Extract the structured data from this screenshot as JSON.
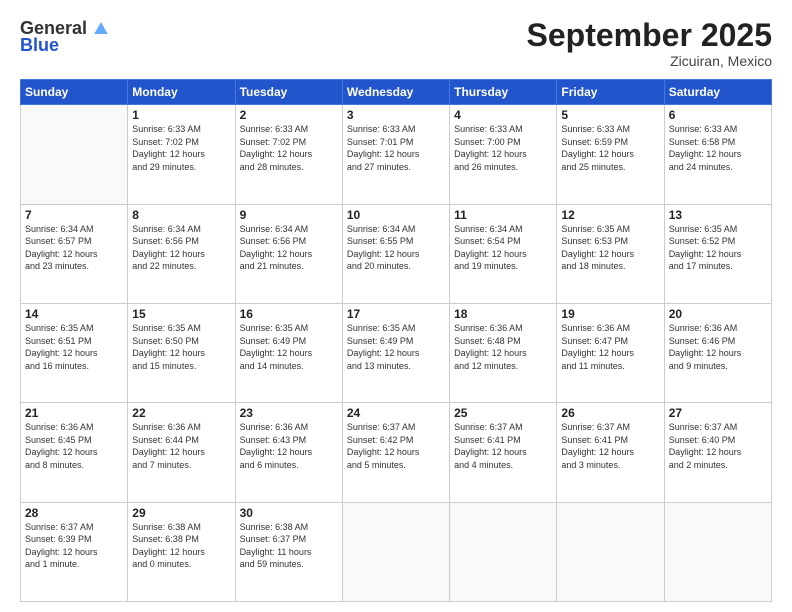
{
  "logo": {
    "general": "General",
    "blue": "Blue"
  },
  "header": {
    "month": "September 2025",
    "location": "Zicuiran, Mexico"
  },
  "days_of_week": [
    "Sunday",
    "Monday",
    "Tuesday",
    "Wednesday",
    "Thursday",
    "Friday",
    "Saturday"
  ],
  "weeks": [
    [
      {
        "num": "",
        "info": ""
      },
      {
        "num": "1",
        "info": "Sunrise: 6:33 AM\nSunset: 7:02 PM\nDaylight: 12 hours\nand 29 minutes."
      },
      {
        "num": "2",
        "info": "Sunrise: 6:33 AM\nSunset: 7:02 PM\nDaylight: 12 hours\nand 28 minutes."
      },
      {
        "num": "3",
        "info": "Sunrise: 6:33 AM\nSunset: 7:01 PM\nDaylight: 12 hours\nand 27 minutes."
      },
      {
        "num": "4",
        "info": "Sunrise: 6:33 AM\nSunset: 7:00 PM\nDaylight: 12 hours\nand 26 minutes."
      },
      {
        "num": "5",
        "info": "Sunrise: 6:33 AM\nSunset: 6:59 PM\nDaylight: 12 hours\nand 25 minutes."
      },
      {
        "num": "6",
        "info": "Sunrise: 6:33 AM\nSunset: 6:58 PM\nDaylight: 12 hours\nand 24 minutes."
      }
    ],
    [
      {
        "num": "7",
        "info": "Sunrise: 6:34 AM\nSunset: 6:57 PM\nDaylight: 12 hours\nand 23 minutes."
      },
      {
        "num": "8",
        "info": "Sunrise: 6:34 AM\nSunset: 6:56 PM\nDaylight: 12 hours\nand 22 minutes."
      },
      {
        "num": "9",
        "info": "Sunrise: 6:34 AM\nSunset: 6:56 PM\nDaylight: 12 hours\nand 21 minutes."
      },
      {
        "num": "10",
        "info": "Sunrise: 6:34 AM\nSunset: 6:55 PM\nDaylight: 12 hours\nand 20 minutes."
      },
      {
        "num": "11",
        "info": "Sunrise: 6:34 AM\nSunset: 6:54 PM\nDaylight: 12 hours\nand 19 minutes."
      },
      {
        "num": "12",
        "info": "Sunrise: 6:35 AM\nSunset: 6:53 PM\nDaylight: 12 hours\nand 18 minutes."
      },
      {
        "num": "13",
        "info": "Sunrise: 6:35 AM\nSunset: 6:52 PM\nDaylight: 12 hours\nand 17 minutes."
      }
    ],
    [
      {
        "num": "14",
        "info": "Sunrise: 6:35 AM\nSunset: 6:51 PM\nDaylight: 12 hours\nand 16 minutes."
      },
      {
        "num": "15",
        "info": "Sunrise: 6:35 AM\nSunset: 6:50 PM\nDaylight: 12 hours\nand 15 minutes."
      },
      {
        "num": "16",
        "info": "Sunrise: 6:35 AM\nSunset: 6:49 PM\nDaylight: 12 hours\nand 14 minutes."
      },
      {
        "num": "17",
        "info": "Sunrise: 6:35 AM\nSunset: 6:49 PM\nDaylight: 12 hours\nand 13 minutes."
      },
      {
        "num": "18",
        "info": "Sunrise: 6:36 AM\nSunset: 6:48 PM\nDaylight: 12 hours\nand 12 minutes."
      },
      {
        "num": "19",
        "info": "Sunrise: 6:36 AM\nSunset: 6:47 PM\nDaylight: 12 hours\nand 11 minutes."
      },
      {
        "num": "20",
        "info": "Sunrise: 6:36 AM\nSunset: 6:46 PM\nDaylight: 12 hours\nand 9 minutes."
      }
    ],
    [
      {
        "num": "21",
        "info": "Sunrise: 6:36 AM\nSunset: 6:45 PM\nDaylight: 12 hours\nand 8 minutes."
      },
      {
        "num": "22",
        "info": "Sunrise: 6:36 AM\nSunset: 6:44 PM\nDaylight: 12 hours\nand 7 minutes."
      },
      {
        "num": "23",
        "info": "Sunrise: 6:36 AM\nSunset: 6:43 PM\nDaylight: 12 hours\nand 6 minutes."
      },
      {
        "num": "24",
        "info": "Sunrise: 6:37 AM\nSunset: 6:42 PM\nDaylight: 12 hours\nand 5 minutes."
      },
      {
        "num": "25",
        "info": "Sunrise: 6:37 AM\nSunset: 6:41 PM\nDaylight: 12 hours\nand 4 minutes."
      },
      {
        "num": "26",
        "info": "Sunrise: 6:37 AM\nSunset: 6:41 PM\nDaylight: 12 hours\nand 3 minutes."
      },
      {
        "num": "27",
        "info": "Sunrise: 6:37 AM\nSunset: 6:40 PM\nDaylight: 12 hours\nand 2 minutes."
      }
    ],
    [
      {
        "num": "28",
        "info": "Sunrise: 6:37 AM\nSunset: 6:39 PM\nDaylight: 12 hours\nand 1 minute."
      },
      {
        "num": "29",
        "info": "Sunrise: 6:38 AM\nSunset: 6:38 PM\nDaylight: 12 hours\nand 0 minutes."
      },
      {
        "num": "30",
        "info": "Sunrise: 6:38 AM\nSunset: 6:37 PM\nDaylight: 11 hours\nand 59 minutes."
      },
      {
        "num": "",
        "info": ""
      },
      {
        "num": "",
        "info": ""
      },
      {
        "num": "",
        "info": ""
      },
      {
        "num": "",
        "info": ""
      }
    ]
  ]
}
